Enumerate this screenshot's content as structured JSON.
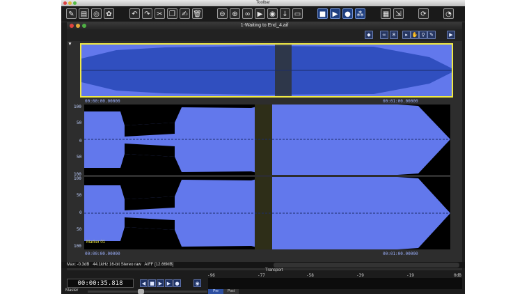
{
  "toolbar": {
    "title": "Toolbar"
  },
  "document": {
    "title": "1-Waiting to End_4.aif",
    "overview_time_start": "00:00:00.00000",
    "overview_time_end": "00:01:00.00000",
    "ruler_start": "00:00:00.00000",
    "ruler_end": "00:01:00.00000",
    "amp_top": "100",
    "amp_50": "50",
    "amp_0": "0",
    "amp_bottom": "100",
    "marker": "Marker 01"
  },
  "status": {
    "max": "Max: -0.3dB",
    "format": "44.1kHz 16-bit Stereo raw",
    "file": "AIFF [12.66MB]"
  },
  "transport": {
    "title": "Transport",
    "time": "00:00:35.818",
    "master": "Master",
    "meter_ticks": [
      "-96",
      "-77",
      "-58",
      "-39",
      "-19",
      "0dB"
    ],
    "pre": "Pre",
    "post": "Post"
  },
  "colors": {
    "waveform_fill": "#6278ec",
    "selection": "#2e2e18",
    "accent_yellow": "#f0ea45"
  },
  "icons": {
    "toolbar_left": [
      "new-file-icon",
      "open-file-icon",
      "globe-icon",
      "app-icon"
    ],
    "toolbar_edit": [
      "undo-icon",
      "redo-icon",
      "cut-icon",
      "copy-icon",
      "paste-icon",
      "trash-icon"
    ],
    "toolbar_transport": [
      "rewind-icon",
      "forward-icon",
      "loop-icon",
      "play-region-icon",
      "speaker-icon",
      "marker-icon",
      "monitor-icon"
    ],
    "toolbar_play": [
      "stop-icon",
      "play-icon",
      "record-icon",
      "metronome-icon"
    ],
    "toolbar_right": [
      "clipboard-icon",
      "export-icon",
      "sync-icon",
      "pie-icon"
    ]
  }
}
